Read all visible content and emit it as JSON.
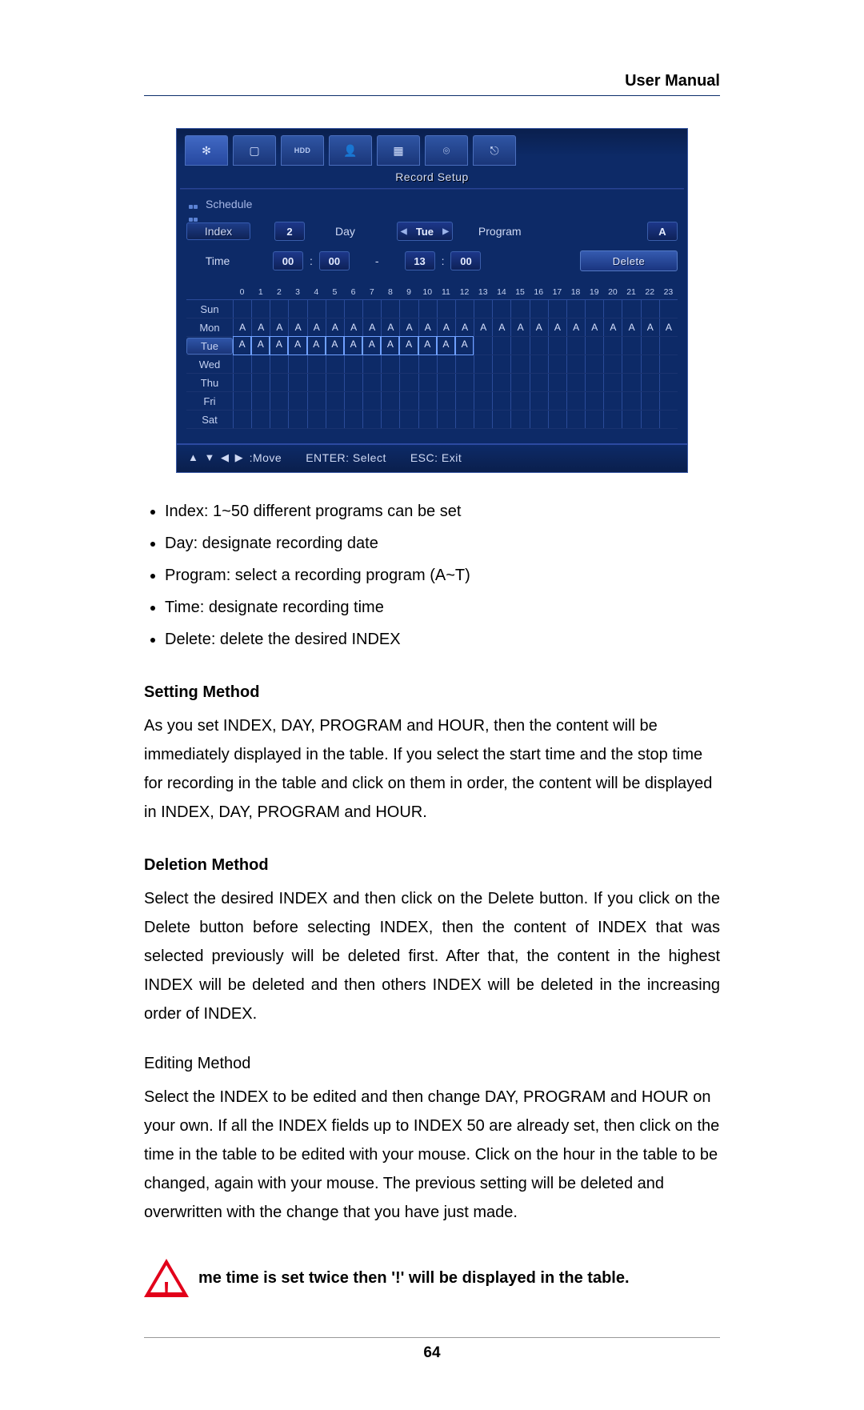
{
  "header": {
    "title": "User Manual"
  },
  "page_number": "64",
  "dvr": {
    "window_title": "Record Setup",
    "section_title": "Schedule",
    "tabs": [
      {
        "name": "gear-icon",
        "label": ""
      },
      {
        "name": "monitor-icon",
        "label": ""
      },
      {
        "name": "hdd-icon",
        "label": "HDD"
      },
      {
        "name": "user-icon",
        "label": ""
      },
      {
        "name": "motion-icon",
        "label": ""
      },
      {
        "name": "tools-icon",
        "label": ""
      },
      {
        "name": "exit-icon",
        "label": ""
      }
    ],
    "fields": {
      "index_label": "Index",
      "index_value": "2",
      "day_label": "Day",
      "day_value": "Tue",
      "program_label": "Program",
      "program_value": "A",
      "time_label": "Time",
      "time_start_hh": "00",
      "time_start_mm": "00",
      "time_dash": "-",
      "time_end_hh": "13",
      "time_end_mm": "00",
      "time_colon": ":",
      "delete_label": "Delete"
    },
    "schedule": {
      "hours": [
        "0",
        "1",
        "2",
        "3",
        "4",
        "5",
        "6",
        "7",
        "8",
        "9",
        "10",
        "11",
        "12",
        "13",
        "14",
        "15",
        "16",
        "17",
        "18",
        "19",
        "20",
        "21",
        "22",
        "23"
      ],
      "days": [
        "Sun",
        "Mon",
        "Tue",
        "Wed",
        "Thu",
        "Fri",
        "Sat"
      ],
      "highlighted_day_index": 2,
      "mon_program": "A",
      "mon_count": 24,
      "tue_program": "A",
      "tue_count": 13
    },
    "footer": {
      "move": ":Move",
      "enter": "ENTER: Select",
      "esc": "ESC: Exit"
    }
  },
  "doc": {
    "bullets": [
      "Index: 1~50 different programs can be set",
      "Day: designate recording date",
      "Program: select a recording program (A~T)",
      "Time: designate recording time",
      "Delete: delete the desired INDEX"
    ],
    "setting_heading": "Setting Method",
    "setting_para": "As you set INDEX, DAY, PROGRAM and HOUR, then the content will be immediately displayed in the table. If you select the start time and the stop time for recording in the table and click on them in order, the content will be displayed in INDEX, DAY, PROGRAM and HOUR.",
    "deletion_heading": "Deletion Method",
    "deletion_para": "Select the desired INDEX and then click on the Delete button. If you click on the Delete button before selecting INDEX, then the content of INDEX that was selected previously will be deleted first. After that, the content in the highest INDEX will be deleted and then others INDEX will be deleted in the increasing order of INDEX.",
    "editing_heading": "Editing Method",
    "editing_para": "Select the INDEX to be edited and then change DAY, PROGRAM and HOUR on your own. If all the INDEX fields up to INDEX 50 are already set, then click on the time in the table to be edited with your mouse. Click on the hour in the table to be changed, again with your mouse. The previous setting will be deleted and overwritten with the change that you have just made.",
    "warning": "me time is set twice then '!' will be displayed in the table."
  }
}
